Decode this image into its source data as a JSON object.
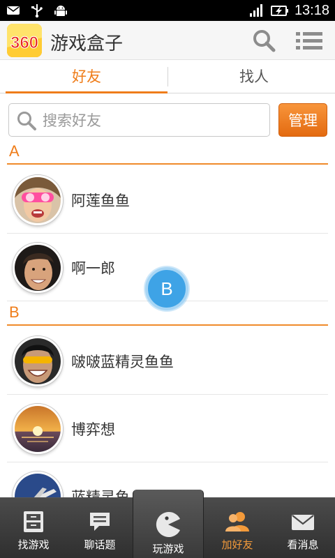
{
  "status_bar": {
    "time": "13:18",
    "left_icons": [
      "mail-icon",
      "usb-icon",
      "android-icon"
    ],
    "right_icons": [
      "signal-icon",
      "battery-charging-icon"
    ]
  },
  "header": {
    "logo_text": "360",
    "title": "游戏盒子",
    "search_icon": "search-icon",
    "menu_icon": "list-menu-icon"
  },
  "tabs": [
    {
      "label": "好友",
      "active": true
    },
    {
      "label": "找人",
      "active": false
    }
  ],
  "search": {
    "placeholder": "搜索好友",
    "value": ""
  },
  "manage_button": {
    "label": "管理"
  },
  "sections": [
    {
      "letter": "A",
      "friends": [
        {
          "name": "阿莲鱼鱼",
          "avatar": "girl-with-goggles"
        },
        {
          "name": "啊一郎",
          "avatar": "smiling-man"
        }
      ]
    },
    {
      "letter": "B",
      "friends": [
        {
          "name": "啵啵蓝精灵鱼鱼",
          "avatar": "laughing-person"
        },
        {
          "name": "博弈想",
          "avatar": "sunset-sea"
        },
        {
          "name": "蓝精灵鱼",
          "avatar": "airplane"
        }
      ]
    }
  ],
  "index_bubble": {
    "letter": "B"
  },
  "bottom_nav": [
    {
      "label": "找游戏",
      "icon": "cabinet-icon",
      "active": false
    },
    {
      "label": "聊话题",
      "icon": "chat-bubble-icon",
      "active": false
    },
    {
      "label": "玩游戏",
      "icon": "pacman-icon",
      "active": false
    },
    {
      "label": "加好友",
      "icon": "add-friends-icon",
      "active": true
    },
    {
      "label": "看消息",
      "icon": "envelope-icon",
      "active": false
    }
  ],
  "colors": {
    "accent": "#ef7d1a",
    "index_bubble": "#3ea3e6",
    "nav_active": "#f39a3a"
  }
}
